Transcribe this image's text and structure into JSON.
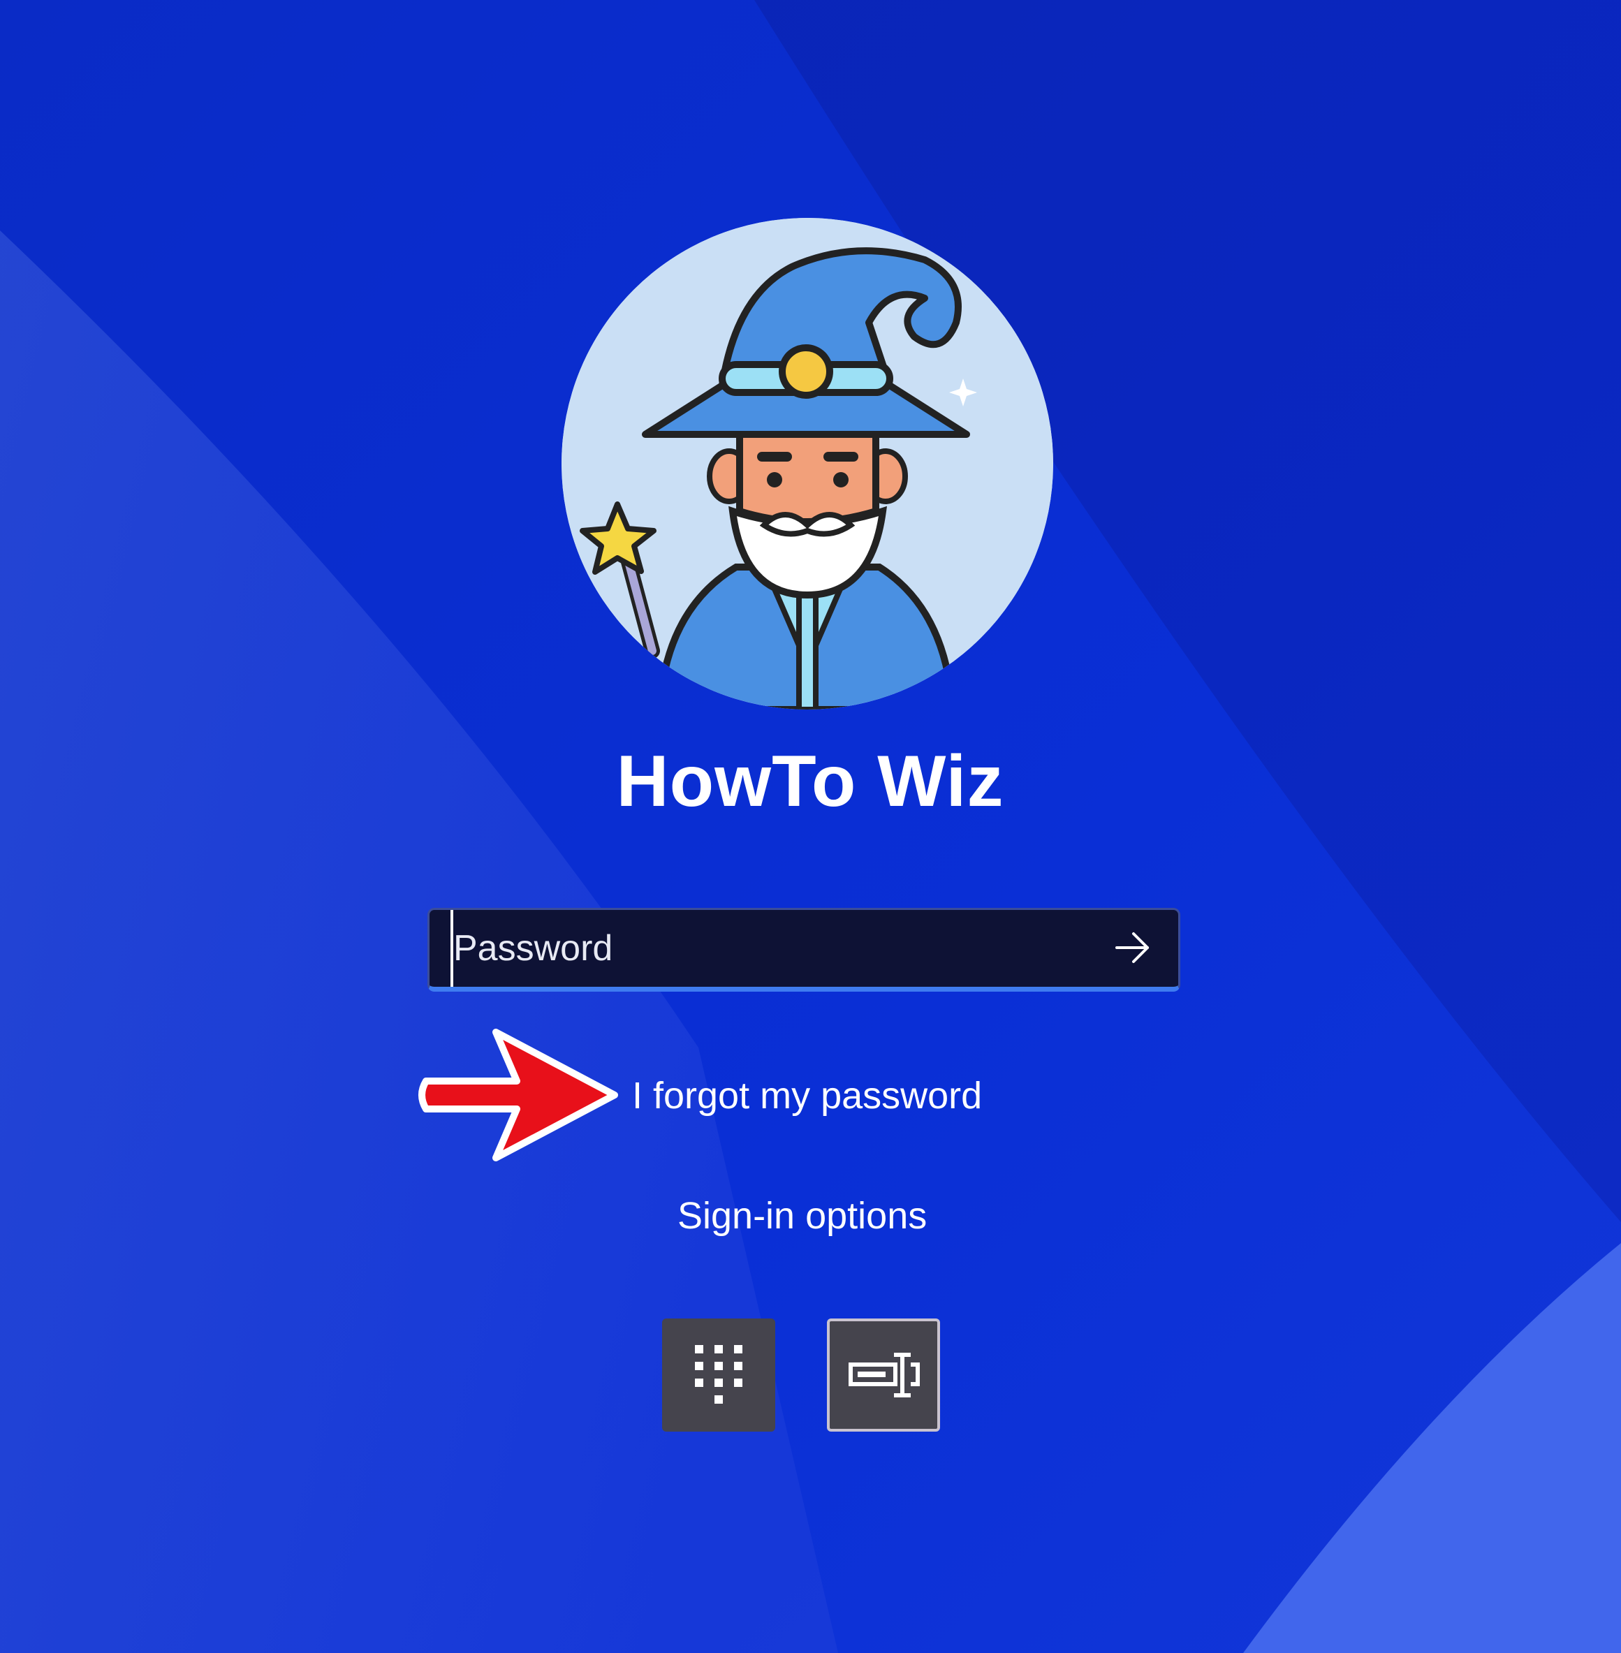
{
  "user": {
    "display_name": "HowTo Wiz",
    "avatar_icon": "wizard-avatar-icon"
  },
  "password": {
    "placeholder": "Password",
    "value": "",
    "submit_icon": "arrow-right-icon"
  },
  "links": {
    "forgot_password": "I forgot my password",
    "sign_in_options": "Sign-in options"
  },
  "sign_in_options": [
    {
      "name": "PIN",
      "icon": "keypad-icon",
      "selected": false
    },
    {
      "name": "Password",
      "icon": "password-field-icon",
      "selected": true
    }
  ],
  "annotation": {
    "icon": "red-arrow-icon",
    "color": "#e8101a"
  },
  "colors": {
    "background": "#0b2fd0",
    "accent": "#3f7cf0",
    "input_background": "#0e1235",
    "option_button": "#45444d"
  }
}
